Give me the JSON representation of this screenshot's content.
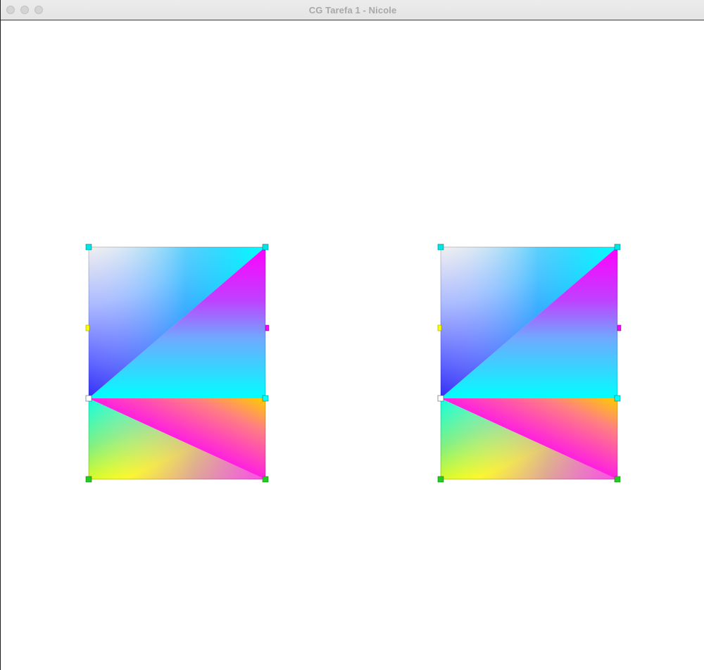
{
  "window": {
    "title": "CG Tarefa 1 - Nicole"
  },
  "controls": {
    "close_icon": "traffic-light-close",
    "minimize_icon": "traffic-light-minimize",
    "zoom_icon": "traffic-light-zoom",
    "inactive_color": "#d4d4d4"
  },
  "scene": {
    "shape_count": 2,
    "vertex_colors": {
      "top_left": "#e8e8e8",
      "top_right": "#00ffff",
      "middle_left": "#ffffff",
      "middle_right": "#00ffff",
      "bottom_left": "#33cc33",
      "bottom_right": "#33cc33",
      "side_left": "#ffff00",
      "side_right": "#ff00ff"
    },
    "fill_colors": {
      "upper_left_triangle_dark": "#1a10f0",
      "upper_right_triangle": "#ff00ff",
      "cyan": "#00ffff",
      "lower_magenta": "#ff00ff",
      "lower_yellow": "#ffff00",
      "lower_orange": "#ffcc00"
    }
  }
}
